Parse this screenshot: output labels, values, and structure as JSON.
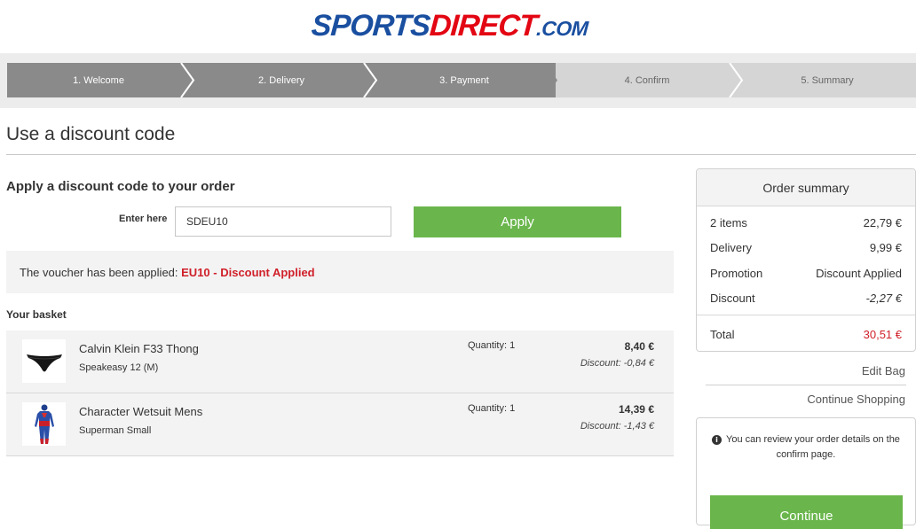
{
  "brand": {
    "part1": "SPORTS",
    "part2": "DIRECT",
    "part3": ".COM",
    "blue": "#1a4fa0",
    "red": "#e30613"
  },
  "steps": [
    {
      "label": "1. Welcome",
      "state": "done"
    },
    {
      "label": "2. Delivery",
      "state": "done"
    },
    {
      "label": "3. Payment",
      "state": "done"
    },
    {
      "label": "4. Confirm",
      "state": "todo"
    },
    {
      "label": "5. Summary",
      "state": "todo"
    }
  ],
  "page_title": "Use a discount code",
  "discount": {
    "section_title": "Apply a discount code to your order",
    "enter_label": "Enter here",
    "code_value": "SDEU10",
    "apply_label": "Apply",
    "voucher_prefix": "The voucher has been applied: ",
    "voucher_status": "EU10 - Discount Applied"
  },
  "basket": {
    "title": "Your basket",
    "items": [
      {
        "name": "Calvin Klein F33 Thong",
        "variant": "Speakeasy 12 (M)",
        "quantity": "Quantity: 1",
        "price": "8,40 €",
        "discount": "Discount: -0,84 €",
        "thumb_icon": "thong-icon"
      },
      {
        "name": "Character Wetsuit Mens",
        "variant": "Superman Small",
        "quantity": "Quantity: 1",
        "price": "14,39 €",
        "discount": "Discount: -1,43 €",
        "thumb_icon": "wetsuit-icon"
      }
    ]
  },
  "summary": {
    "title": "Order summary",
    "rows": [
      {
        "label": "2 items",
        "value": "22,79 €"
      },
      {
        "label": "Delivery",
        "value": "9,99 €"
      },
      {
        "label": "Promotion",
        "value": "Discount Applied"
      },
      {
        "label": "Discount",
        "value": "-2,27 €"
      }
    ],
    "total_label": "Total",
    "total_value": "30,51 €"
  },
  "links": {
    "edit_bag": "Edit Bag",
    "continue_shopping": "Continue Shopping"
  },
  "confirm": {
    "info_icon": "i",
    "note": "You can review your order details on the confirm page.",
    "continue_label": "Continue"
  },
  "colors": {
    "green": "#6ab64c",
    "red_text": "#d0202a",
    "step_done": "#8a8a8a",
    "step_todo": "#d5d5d5"
  }
}
